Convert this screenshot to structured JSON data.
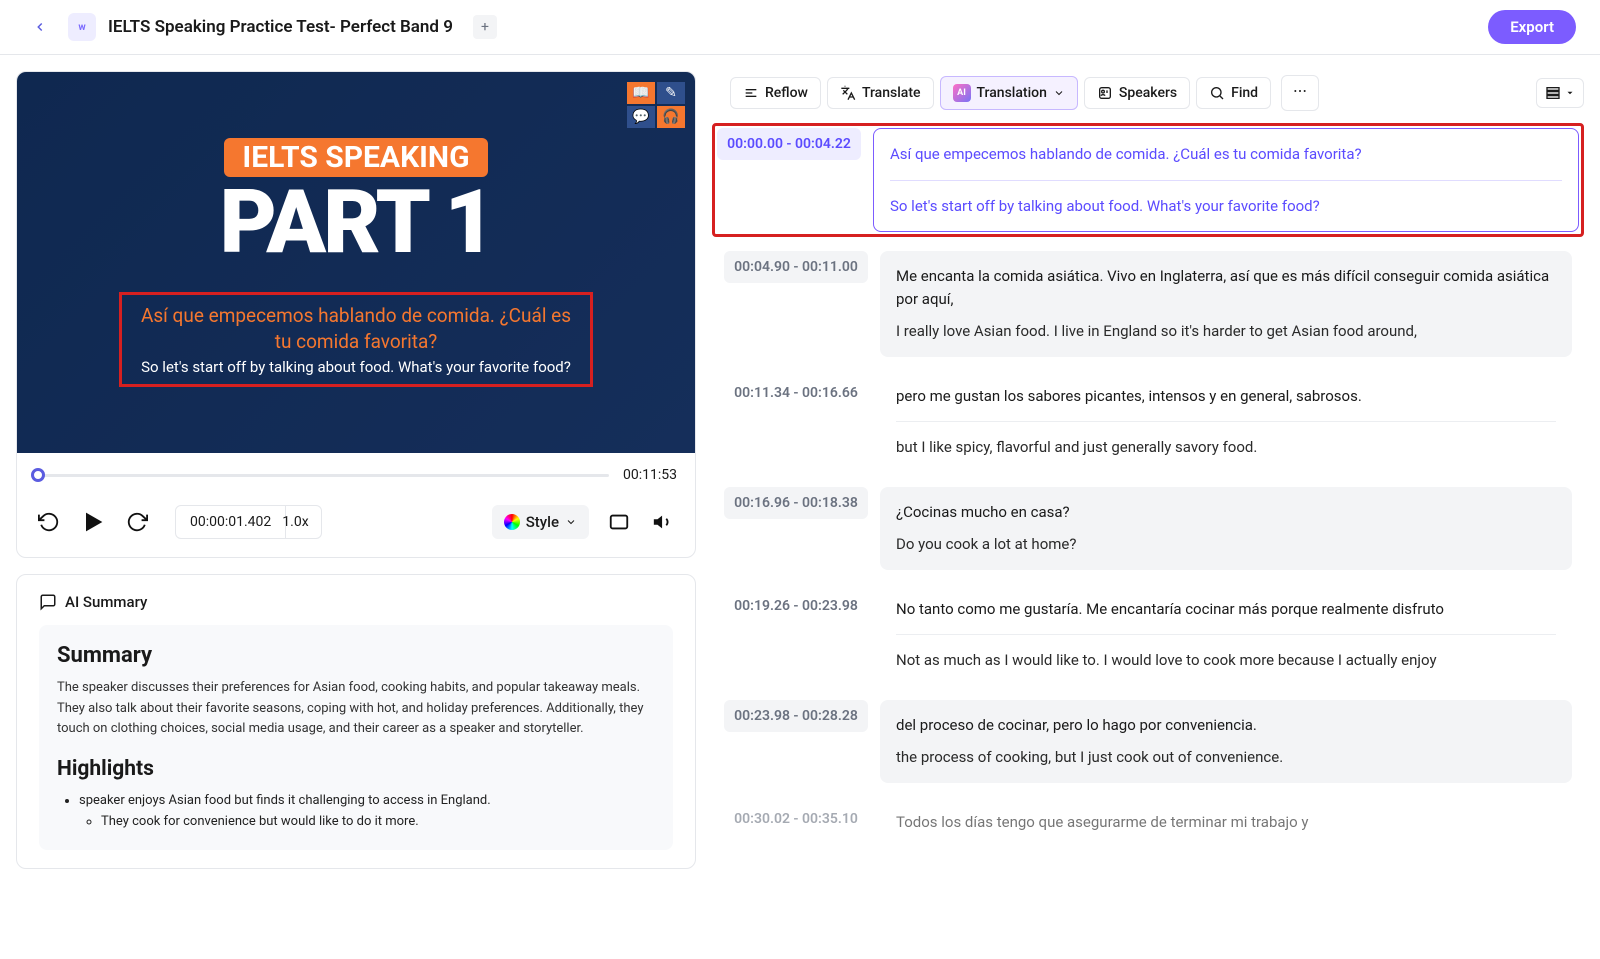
{
  "header": {
    "title": "IELTS Speaking Practice Test- Perfect Band 9",
    "export_label": "Export"
  },
  "video": {
    "headline": "IELTS SPEAKING",
    "part": "PART 1",
    "subtitle_es": "Así que empecemos hablando de comida. ¿Cuál es tu comida favorita?",
    "subtitle_en": "So let's start off by talking about food. What's your favorite food?",
    "duration_display": "00:11:53",
    "current_time": "00:00:01.402",
    "rate": "1.0x",
    "style_label": "Style"
  },
  "summary": {
    "ai_label": "AI Summary",
    "summary_heading": "Summary",
    "summary_text": "The speaker discusses their preferences for Asian food, cooking habits, and popular takeaway meals. They also talk about their favorite seasons, coping with hot, and holiday preferences. Additionally, they touch on clothing choices, social media usage, and their career as a speaker and storyteller.",
    "highlights_heading": "Highlights",
    "hl1": "speaker enjoys Asian food but finds it challenging to access in England.",
    "hl1a": "They cook for convenience but would like to do it more."
  },
  "toolbar": {
    "reflow": "Reflow",
    "translate": "Translate",
    "translation": "Translation",
    "speakers": "Speakers",
    "find": "Find"
  },
  "segments": [
    {
      "time": "00:00.00 - 00:04.22",
      "es": "Así que empecemos hablando de comida. ¿Cuál es tu comida favorita?",
      "en": "So let's start off by talking about food. What's your favorite food?"
    },
    {
      "time": "00:04.90 - 00:11.00",
      "es": "Me encanta la comida asiática. Vivo en Inglaterra, así que es más difícil conseguir comida asiática por aquí,",
      "en": "I really love Asian food. I live in England so it's harder to get Asian food around,"
    },
    {
      "time": "00:11.34  -  00:16.66",
      "es": "pero me gustan los sabores picantes, intensos y en general, sabrosos.",
      "en": "but I like spicy, flavorful and just generally savory food."
    },
    {
      "time": "00:16.96  -  00:18.38",
      "es": "¿Cocinas mucho en casa?",
      "en": "Do you cook a lot at home?"
    },
    {
      "time": "00:19.26  -  00:23.98",
      "es": "No tanto como me gustaría. Me encantaría cocinar más porque realmente disfruto",
      "en": "Not as much as I would like to. I would love to cook more because I actually enjoy"
    },
    {
      "time": "00:23.98  -  00:28.28",
      "es": "del proceso de cocinar, pero lo hago por conveniencia.",
      "en": "the process of cooking, but I just cook out of convenience."
    },
    {
      "time": "00:30.02  -  00:35.10",
      "es": "Todos los días tengo que asegurarme de terminar mi trabajo y",
      "en": ""
    }
  ]
}
